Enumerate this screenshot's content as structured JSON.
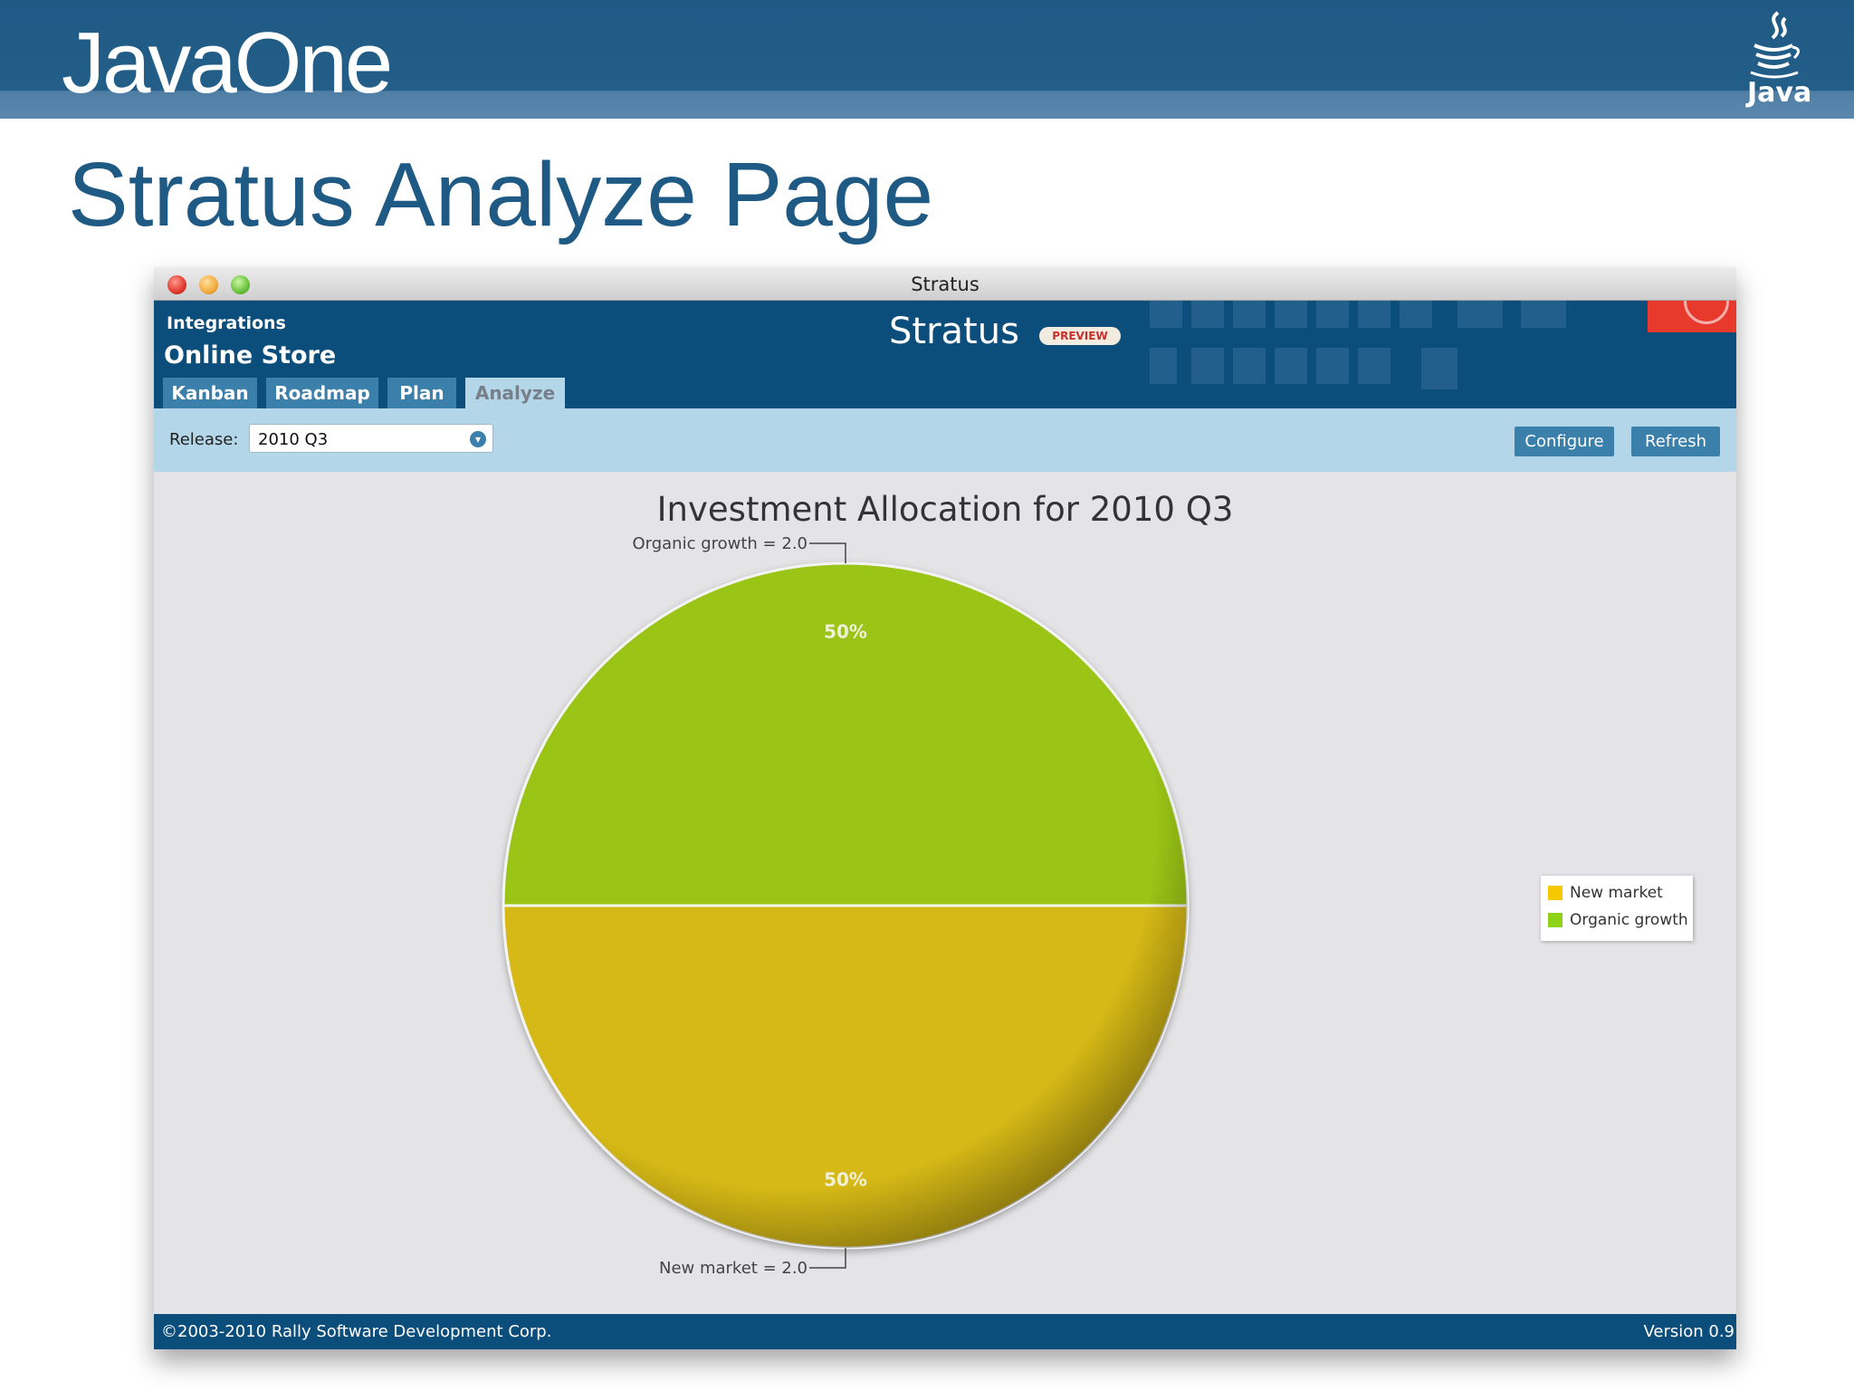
{
  "slide": {
    "brand": "JavaOne",
    "title": "Stratus Analyze Page",
    "java_logo_text": "Java"
  },
  "window": {
    "title": "Stratus",
    "traffic_lights": [
      "close",
      "minimize",
      "maximize"
    ]
  },
  "app": {
    "breadcrumb": "Integrations",
    "project": "Online Store",
    "name": "Stratus",
    "badge": "PREVIEW",
    "tabs": [
      {
        "label": "Kanban",
        "active": false
      },
      {
        "label": "Roadmap",
        "active": false
      },
      {
        "label": "Plan",
        "active": false
      },
      {
        "label": "Analyze",
        "active": true
      }
    ]
  },
  "toolbar": {
    "release_label": "Release:",
    "release_value": "2010 Q3",
    "configure_label": "Configure",
    "refresh_label": "Refresh"
  },
  "chart_data": {
    "type": "pie",
    "title": "Investment Allocation for 2010 Q3",
    "slices": [
      {
        "name": "Organic growth",
        "value": 2.0,
        "percent": "50%",
        "label": "Organic growth = 2.0",
        "color": "#9ac412"
      },
      {
        "name": "New market",
        "value": 2.0,
        "percent": "50%",
        "label": "New market = 2.0",
        "color": "#d6b912"
      }
    ],
    "legend": [
      {
        "name": "New market",
        "color": "#f5c800"
      },
      {
        "name": "Organic growth",
        "color": "#8fd21a"
      }
    ],
    "legend_position": "right"
  },
  "footer": {
    "copyright": "©2003-2010 Rally Software Development Corp.",
    "version": "Version 0.9"
  },
  "colors": {
    "banner": "#1f5a85",
    "app_header": "#0c4e7b",
    "toolbar": "#b3d6e9",
    "button": "#3b7fab"
  }
}
